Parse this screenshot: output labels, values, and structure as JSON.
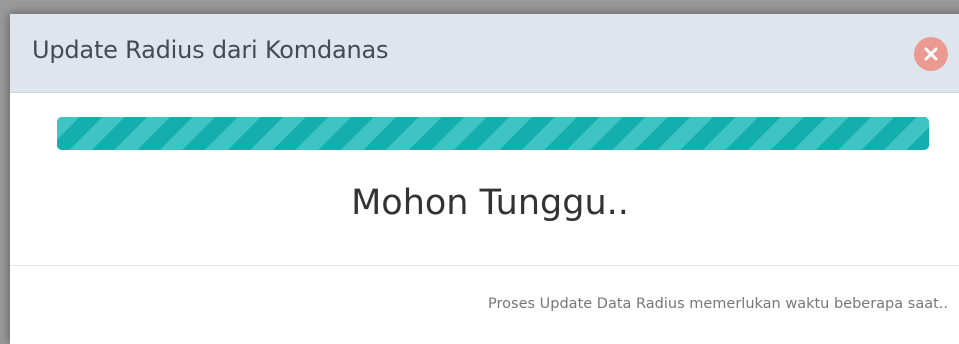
{
  "modal": {
    "title": "Update Radius dari Komdanas",
    "close_icon": "close-icon",
    "progress": {
      "percent": 100,
      "style": "striped-animated",
      "color": "#14aeae",
      "stripe_color": "#3fc4c3"
    },
    "message": "Mohon Tunggu..",
    "footer_note": "Proses Update Data Radius memerlukan waktu beberapa saat..",
    "colors": {
      "header_bg": "#dfe5ee",
      "close_button_bg": "#eb9a92"
    }
  }
}
